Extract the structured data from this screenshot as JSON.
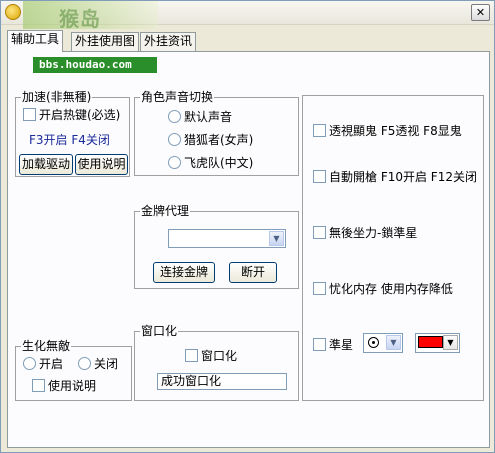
{
  "window": {
    "watermark_text": "猴岛",
    "watermark_url": "bbs.houdao.com",
    "close_label": "✕"
  },
  "tabs": [
    "辅助工具",
    "外挂使用图",
    "外挂资讯"
  ],
  "speed_group": {
    "title": "加速(非無種)",
    "hotkey_checkbox": "开启热键(必选)",
    "hotkeys_info": "F3开启 F4关闭",
    "load_driver_button": "加载驱动",
    "usage_button": "使用说明"
  },
  "voice_group": {
    "title": "角色声音切换",
    "options": [
      "默认声音",
      "猎狐者(女声)",
      "飞虎队(中文)"
    ]
  },
  "gold_group": {
    "title": "金牌代理",
    "combo_value": "",
    "connect_button": "连接金牌",
    "disconnect_button": "断开"
  },
  "invincible_group": {
    "title": "生化無敵",
    "on_label": "开启",
    "off_label": "关闭",
    "usage_checkbox": "使用说明"
  },
  "window_group": {
    "title": "窗口化",
    "checkbox": "窗口化",
    "status_text": "成功窗口化"
  },
  "right_panel": {
    "xray": "透視顯鬼 F5透视 F8显鬼",
    "auto_fire": "自動開槍 F10开启 F12关闭",
    "no_recoil": "無後坐力-鎖準星",
    "mem_opt": "忧化内存 使用内存降低",
    "crosshair": "準星",
    "crosshair_color": "#ff0000",
    "arrow_glyph": "▼"
  }
}
